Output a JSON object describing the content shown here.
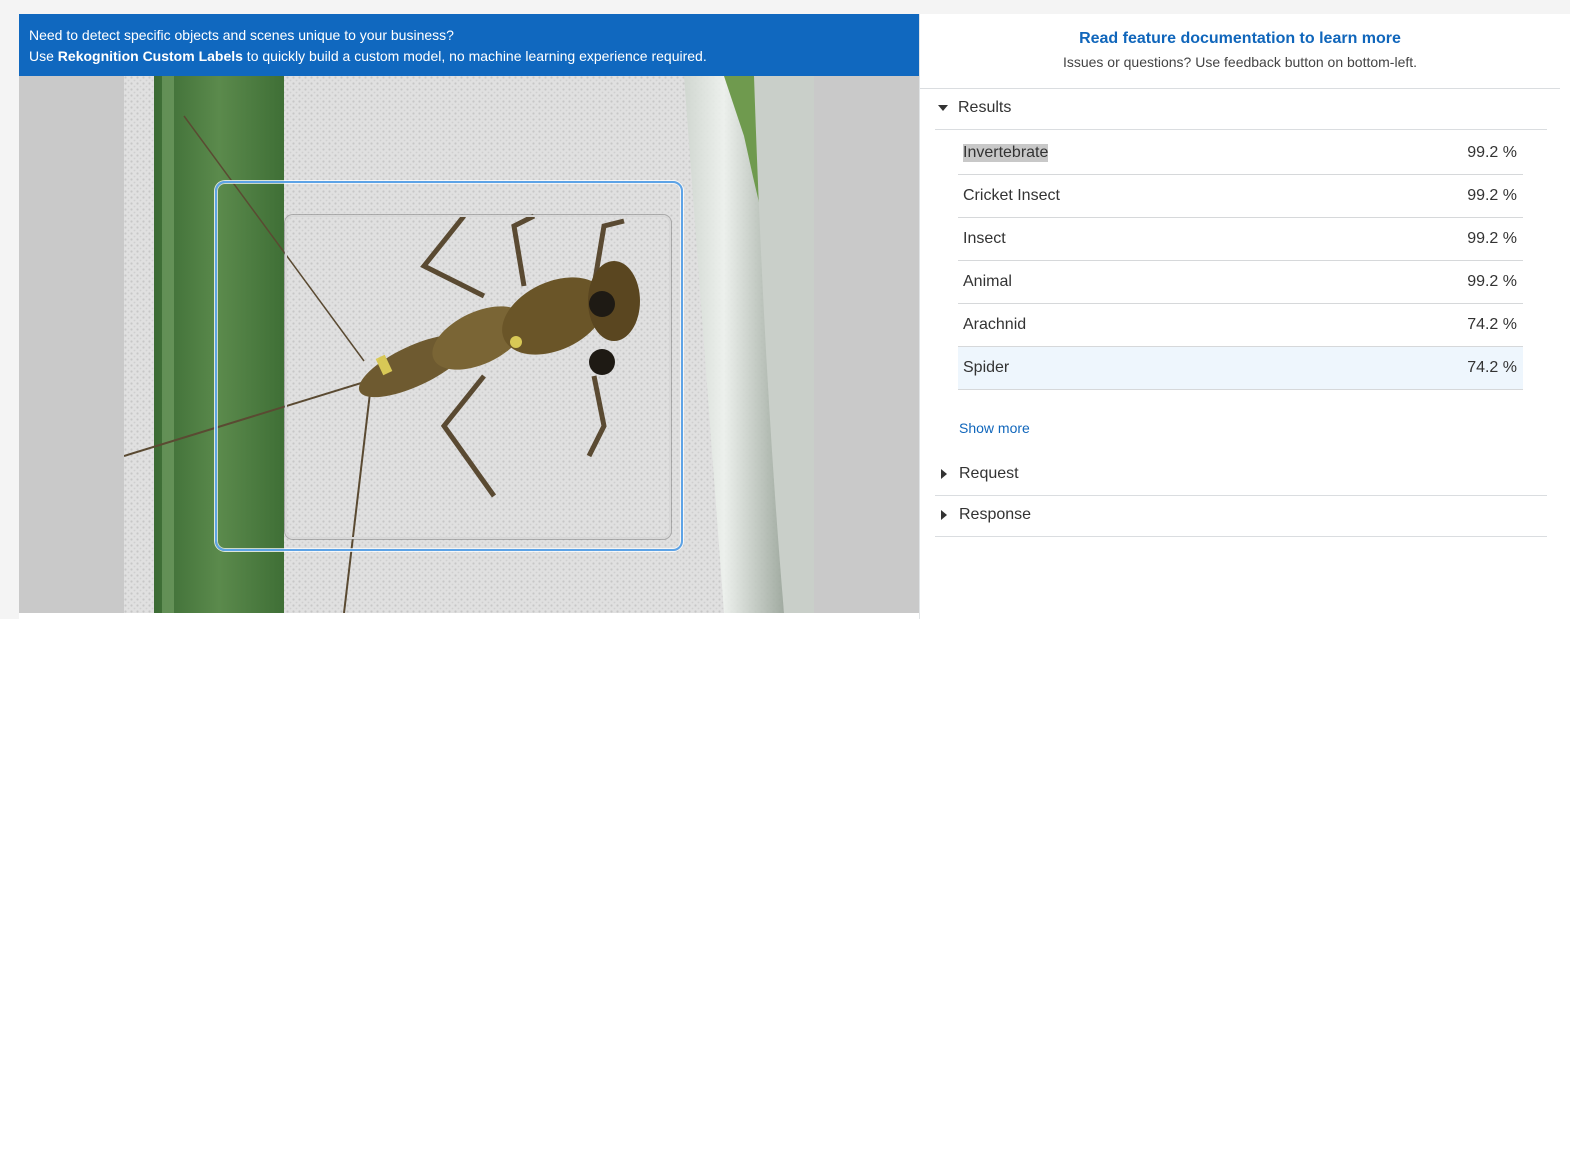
{
  "banner": {
    "line1": "Need to detect specific objects and scenes unique to your business?",
    "line2_prefix": "Use ",
    "line2_bold": "Rekognition Custom Labels",
    "line2_suffix": " to quickly build a custom model, no machine learning experience required."
  },
  "side_header": {
    "doc_link": "Read feature documentation to learn more",
    "feedback_note": "Issues or questions? Use feedback button on bottom-left."
  },
  "results": {
    "title": "Results",
    "rows": [
      {
        "label": "Invertebrate",
        "confidence": "99.2 %"
      },
      {
        "label": "Cricket Insect",
        "confidence": "99.2 %"
      },
      {
        "label": "Insect",
        "confidence": "99.2 %"
      },
      {
        "label": "Animal",
        "confidence": "99.2 %"
      },
      {
        "label": "Arachnid",
        "confidence": "74.2 %"
      },
      {
        "label": "Spider",
        "confidence": "74.2 %"
      }
    ],
    "show_more": "Show more"
  },
  "sections": {
    "request": "Request",
    "response": "Response"
  },
  "colors": {
    "banner": "#1068bf",
    "link": "#1066bb",
    "bbox_selected": "#5da3e6",
    "row_highlight": "#eef6fd"
  }
}
